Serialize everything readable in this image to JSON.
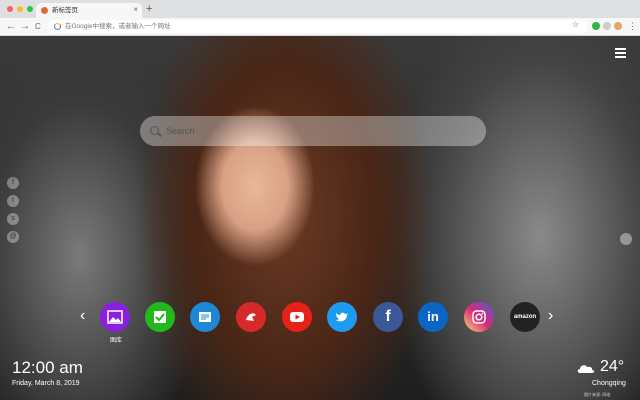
{
  "browser": {
    "tab_title": "新标签页",
    "tab_close": "×",
    "new_tab": "+",
    "back": "←",
    "forward": "→",
    "reload": "C",
    "omnibox_placeholder": "在Google中搜索，或者输入一个网址",
    "bookmark_star": "☆",
    "menu": "⋮"
  },
  "page": {
    "search_placeholder": "Search",
    "social_links": [
      {
        "icon": "facebook-icon",
        "glyph": "f"
      },
      {
        "icon": "twitter-icon",
        "glyph": "t"
      },
      {
        "icon": "snapchat-icon",
        "glyph": "s"
      },
      {
        "icon": "mail-icon",
        "glyph": "@"
      }
    ],
    "apps": [
      {
        "name": "gallery",
        "label": "图库",
        "color": "#8a1fe0"
      },
      {
        "name": "checklist",
        "color": "#22b81e"
      },
      {
        "name": "notes",
        "color": "#1e88d4"
      },
      {
        "name": "game",
        "color": "#d62a2a"
      },
      {
        "name": "youtube",
        "color": "#e62117"
      },
      {
        "name": "twitter",
        "color": "#1d9bf0"
      },
      {
        "name": "facebook",
        "glyph": "f",
        "color": "#3b5998"
      },
      {
        "name": "linkedin",
        "glyph": "in",
        "color": "#0a66c2"
      },
      {
        "name": "instagram",
        "color": "#d6249f"
      },
      {
        "name": "amazon",
        "glyph": "amazon",
        "color": "#222222"
      }
    ],
    "arrow_left": "‹",
    "arrow_right": "›",
    "clock": "12:00 am",
    "date": "Friday, March 8, 2019",
    "temperature": "24°",
    "city": "Chongqing",
    "credit": "图片来源: 网络"
  }
}
